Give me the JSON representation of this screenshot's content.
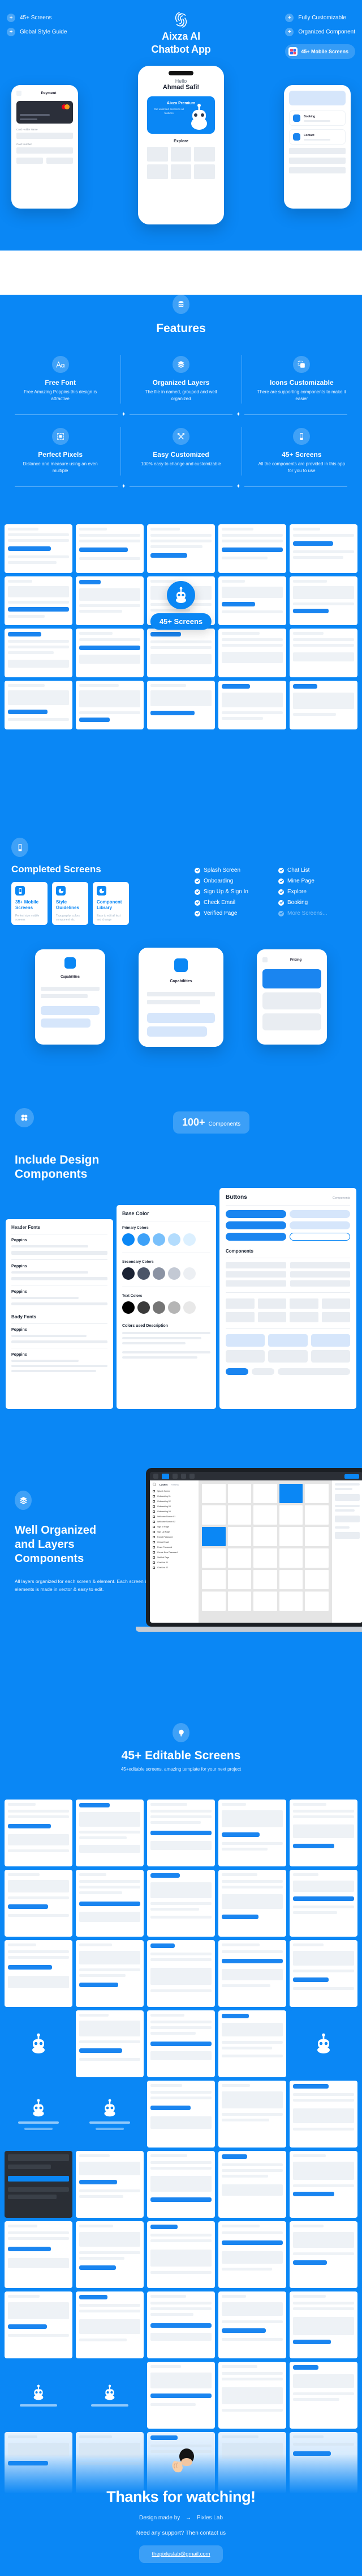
{
  "brand": {
    "accent": "#0a87f5",
    "white": "#ffffff",
    "logo_icon": "spiral-logo-icon"
  },
  "hero": {
    "title_line1": "Aixza AI",
    "title_line2": "Chatbot App",
    "bullets_left": [
      {
        "label": "45+ Screens",
        "icon": "plus-icon"
      },
      {
        "label": "Global Style Guide",
        "icon": "plus-icon"
      }
    ],
    "bullets_right": [
      {
        "label": "Fully Customizable",
        "icon": "plus-icon"
      },
      {
        "label": "Organized Component",
        "icon": "plus-icon"
      }
    ],
    "pill": {
      "label": "45+ Mobile Screens",
      "icon": "mobile-screens-icon"
    },
    "phone_left": {
      "title": "Payment",
      "card_label": "Card Holder Name",
      "card_number_label": "Card Number",
      "brand": "Mastercard"
    },
    "phone_center": {
      "greeting": "Hello",
      "name": "Ahmad Safi!",
      "premium_title": "Aixza Premium",
      "premium_desc": "Get unlimited access to all features",
      "explore_label": "Explore"
    },
    "phone_right": {
      "title": "Booking",
      "item1": "Booking",
      "item2": "Contact"
    }
  },
  "features": {
    "icon": "database-icon",
    "title": "Features",
    "items": [
      {
        "icon": "font-aa-icon",
        "name": "Free Font",
        "desc": "Free Amazing Poppins this design is attractive"
      },
      {
        "icon": "layers-icon",
        "name": "Organized Layers",
        "desc": "The file in named, grouped and well organized"
      },
      {
        "icon": "copy-icon",
        "name": "Icons Customizable",
        "desc": "There are supporting components to make it easier"
      },
      {
        "icon": "frame-icon",
        "name": "Perfect Pixels",
        "desc": "Distance and measure using an even multiple"
      },
      {
        "icon": "tools-icon",
        "name": "Easy Customized",
        "desc": "100% easy to change and customizable"
      },
      {
        "icon": "mobile-icon",
        "name": "45+ Screens",
        "desc": "All the components are provided in this app for you to use"
      }
    ]
  },
  "gallery": {
    "badge": "45+ Screens",
    "bot_icon": "robot-icon"
  },
  "completed": {
    "icon": "mobile-icon",
    "title": "Completed Screens",
    "cards": [
      {
        "icon": "mobile-icon",
        "title": "35+ Mobile Screens",
        "desc": "Perfect size mobile screens"
      },
      {
        "icon": "pie-icon",
        "title": "Style Guidelines",
        "desc": "Typography, colors component etc."
      },
      {
        "icon": "pie-icon",
        "title": "Component Library",
        "desc": "Easy to edit all text and change"
      }
    ],
    "checklist": [
      {
        "label": "Splash Screen",
        "dim": false
      },
      {
        "label": "Chat List",
        "dim": false
      },
      {
        "label": "Onboarding",
        "dim": false
      },
      {
        "label": "Mine Page",
        "dim": false
      },
      {
        "label": "Sign Up & Sign In",
        "dim": false
      },
      {
        "label": "Explore",
        "dim": false
      },
      {
        "label": "Check Email",
        "dim": false
      },
      {
        "label": "Booking",
        "dim": false
      },
      {
        "label": "Verified Page",
        "dim": false
      },
      {
        "label": "More Screens...",
        "dim": true
      }
    ],
    "phone_labels": {
      "left": "Capabilities",
      "center": "Capabilities",
      "right": "Pricing"
    }
  },
  "include_design": {
    "icon": "components-grid-icon",
    "pill_number": "100+",
    "pill_text": "Components",
    "title_line1": "Include Design",
    "title_line2": "Components",
    "panel_buttons_title": "Buttons",
    "panel_buttons_tag": "Components",
    "panel_components_title": "Components",
    "panel_base_color": "Base Color",
    "panel_primary": "Primary Colors",
    "panel_secondary": "Secondary Colors",
    "panel_text_colors": "Text Colors",
    "panel_header_fonts": "Header Fonts",
    "panel_body_fonts": "Body Fonts",
    "panel_colors_desc": "Colors used Description"
  },
  "well_organized": {
    "icon": "layers-icon",
    "title_line1": "Well Organized",
    "title_line2": "and Layers",
    "title_line3": "Components",
    "desc": "All layers organized for each screen & element. Each screen & elements is made in vector & easy to edit.",
    "figma_panel": {
      "layers_label": "Layers",
      "assets_label": "Assets",
      "layers": [
        "Splash Screen",
        "Onboarding 01",
        "Onboarding 02",
        "Onboarding 03",
        "Onboarding 04",
        "Welcome Screen 01",
        "Welcome Screen 02",
        "Sign In Page",
        "Sign Up Page",
        "Forgot Password",
        "Check Email",
        "Reset Password",
        "Create New Password",
        "Verified Page",
        "Chat List 01",
        "Chat List 02"
      ]
    }
  },
  "editable": {
    "icon": "bulb-icon",
    "title": "45+ Editable Screens",
    "subtitle": "45+editable screens, amazing template for your next project"
  },
  "footer": {
    "thanks": "Thanks for watching!",
    "made_by_prefix": "Design made by",
    "made_by_arrow": "→",
    "made_by_name": "Pixles Lab",
    "support": "Need any support? Then contact us",
    "email": "thepixleslab@gmail.com"
  }
}
